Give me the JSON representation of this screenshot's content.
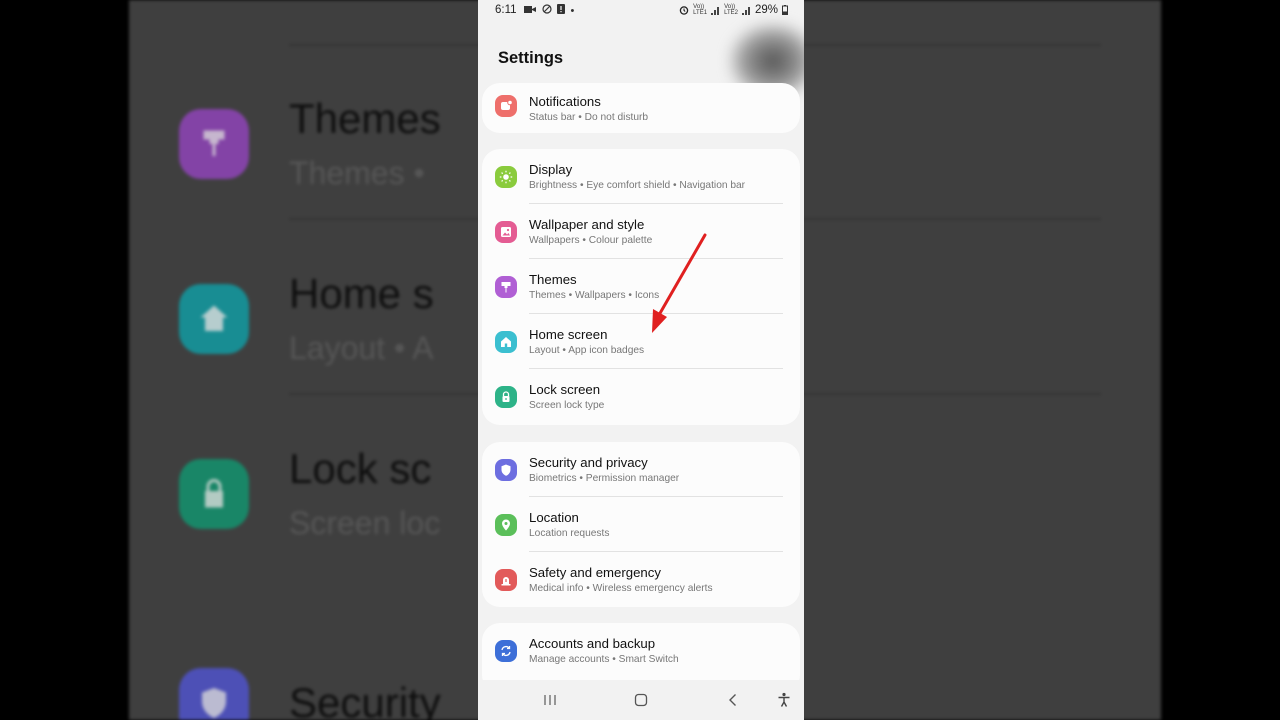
{
  "background": {
    "rows": [
      {
        "title": "Themes",
        "subtitle": "Themes  •",
        "icon": "themes-icon",
        "color": "#9b4fc4"
      },
      {
        "title": "Home s",
        "subtitle": "Layout  •  A",
        "icon": "home-icon",
        "color": "#1da6ad"
      },
      {
        "title": "Lock sc",
        "subtitle": "Screen loc",
        "icon": "lock-icon",
        "color": "#1e9e7a"
      },
      {
        "title": "Security",
        "subtitle": "",
        "icon": "shield-icon",
        "color": "#5b5fd6"
      }
    ]
  },
  "status_bar": {
    "time": "6:11",
    "battery": "29%",
    "sim1": "Vo))\nLTE1",
    "sim2": "Vo))\nLTE2"
  },
  "header": {
    "title": "Settings"
  },
  "groups": [
    {
      "items": [
        {
          "title": "Notifications",
          "subtitle": "Status bar  •  Do not disturb",
          "icon": "notifications-icon",
          "color": "#ee6f6b"
        }
      ]
    },
    {
      "items": [
        {
          "title": "Display",
          "subtitle": "Brightness  •  Eye comfort shield  •  Navigation bar",
          "icon": "display-icon",
          "color": "#8acb3d"
        },
        {
          "title": "Wallpaper and style",
          "subtitle": "Wallpapers  •  Colour palette",
          "icon": "wallpaper-icon",
          "color": "#e45c93"
        },
        {
          "title": "Themes",
          "subtitle": "Themes  •  Wallpapers  •  Icons",
          "icon": "themes-icon",
          "color": "#b05fd4"
        },
        {
          "title": "Home screen",
          "subtitle": "Layout  •  App icon badges",
          "icon": "home-icon",
          "color": "#3bbfd0"
        },
        {
          "title": "Lock screen",
          "subtitle": "Screen lock type",
          "icon": "lock-icon",
          "color": "#2db388"
        }
      ]
    },
    {
      "items": [
        {
          "title": "Security and privacy",
          "subtitle": "Biometrics  •  Permission manager",
          "icon": "shield-icon",
          "color": "#6d6ee0"
        },
        {
          "title": "Location",
          "subtitle": "Location requests",
          "icon": "location-icon",
          "color": "#5bbf5a"
        },
        {
          "title": "Safety and emergency",
          "subtitle": "Medical info  •  Wireless emergency alerts",
          "icon": "emergency-icon",
          "color": "#e25a5a"
        }
      ]
    },
    {
      "items": [
        {
          "title": "Accounts and backup",
          "subtitle": "Manage accounts  •  Smart Switch",
          "icon": "sync-icon",
          "color": "#3d6fd8"
        }
      ]
    }
  ],
  "navigation_bar": {
    "buttons": [
      "recent-apps-icon",
      "home-button-icon",
      "back-icon",
      "accessibility-icon"
    ]
  },
  "annotation": {
    "color": "#e02020"
  }
}
